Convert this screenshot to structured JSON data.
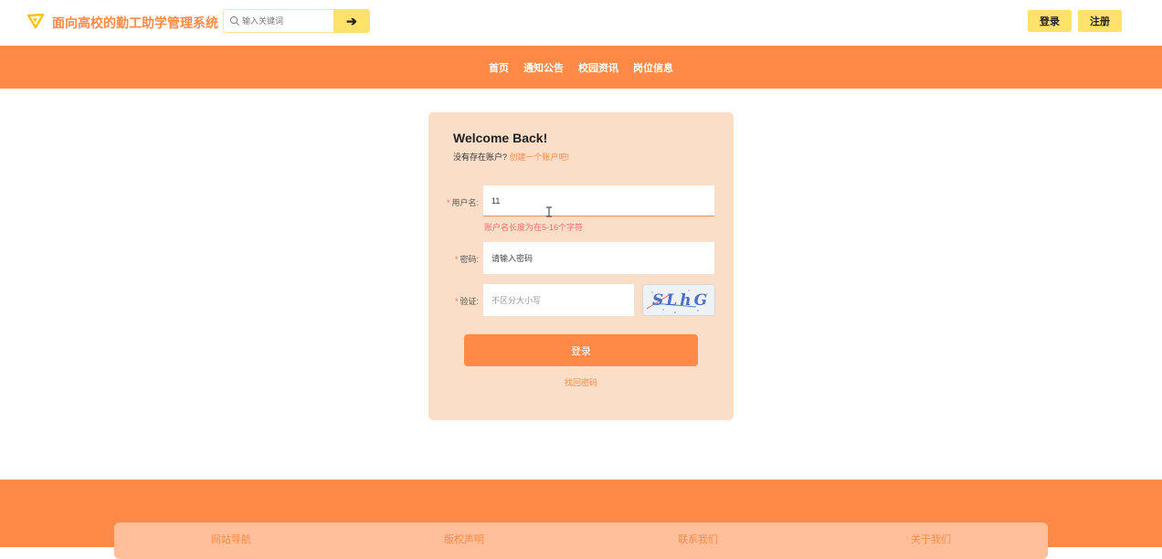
{
  "header": {
    "site_title": "面向高校的勤工助学管理系统",
    "search_placeholder": "输入关键词",
    "search_button": "➔",
    "login": "登录",
    "register": "注册"
  },
  "nav": {
    "items": [
      "首页",
      "通知公告",
      "校园资讯",
      "岗位信息"
    ]
  },
  "login_form": {
    "title": "Welcome Back!",
    "subtitle": "没有存在账户? ",
    "create_link": "创建一个账户吧!",
    "username_label": "用户名:",
    "username_value": "11",
    "username_error": "账户名长度为在5-16个字符",
    "password_label": "密码:",
    "password_placeholder": "请输入密码",
    "captcha_label": "验证:",
    "captcha_placeholder": "不区分大小写",
    "captcha_text": "SLhG",
    "submit": "登录",
    "forgot": "找回密码"
  },
  "footer": {
    "columns": [
      "网站导航",
      "版权声明",
      "联系我们",
      "关于我们"
    ]
  },
  "colors": {
    "primary": "#ff8a47",
    "accent_yellow": "#ffe26b",
    "card_bg": "#fadec8",
    "error": "#f56c6c"
  }
}
